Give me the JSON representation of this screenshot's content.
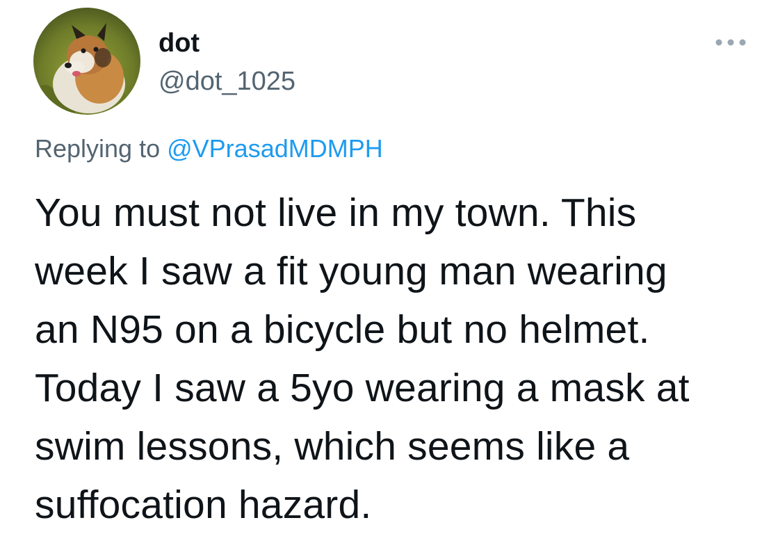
{
  "author": {
    "display_name": "dot",
    "handle": "@dot_1025",
    "avatar_icon": "sheltie-dog-avatar"
  },
  "more_icon": "more-horizontal-icon",
  "reply": {
    "prefix": "Replying to ",
    "mention": "@VPrasadMDMPH"
  },
  "tweet": {
    "lines": [
      "You must not live in my town. This",
      "week I saw a fit young man wearing",
      "an N95 on a bicycle but no helmet.",
      "Today I saw a 5yo wearing a mask at",
      "swim lessons, which seems like a",
      "suffocation hazard."
    ]
  },
  "colors": {
    "text_primary": "#0f1419",
    "text_secondary": "#536471",
    "accent": "#1d9bf0"
  }
}
